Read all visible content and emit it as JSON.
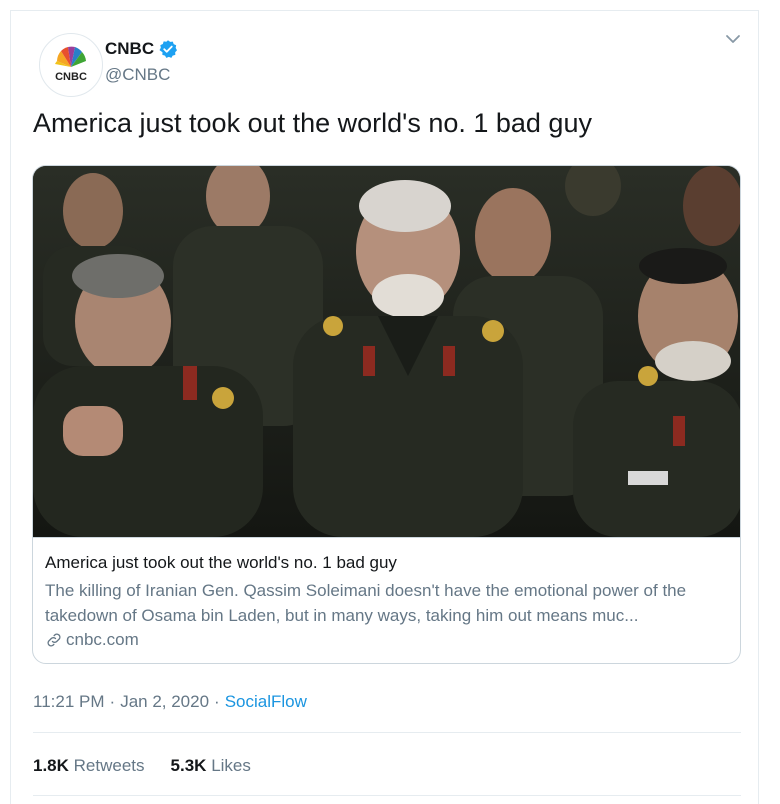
{
  "author": {
    "name": "CNBC",
    "handle": "@CNBC",
    "avatar_text": "CNBC",
    "verified": true
  },
  "tweet": {
    "text": "America just took out the world's no. 1 bad guy"
  },
  "card": {
    "title": "America just took out the world's no. 1 bad guy",
    "description": "The killing of Iranian Gen. Qassim Soleimani doesn't have the emotional power of the takedown of Osama bin Laden, but in many ways, taking him out means muc...",
    "domain": "cnbc.com"
  },
  "meta": {
    "time": "11:21 PM",
    "separator1": "·",
    "date": "Jan 2, 2020",
    "separator2": "·",
    "source": "SocialFlow"
  },
  "stats": {
    "retweets_count": "1.8K",
    "retweets_label": "Retweets",
    "likes_count": "5.3K",
    "likes_label": "Likes"
  },
  "colors": {
    "accent": "#1b95e0",
    "verified": "#1da1f2",
    "muted": "#657786"
  },
  "icons": [
    "verified-badge-icon",
    "chevron-down-icon",
    "link-icon"
  ]
}
